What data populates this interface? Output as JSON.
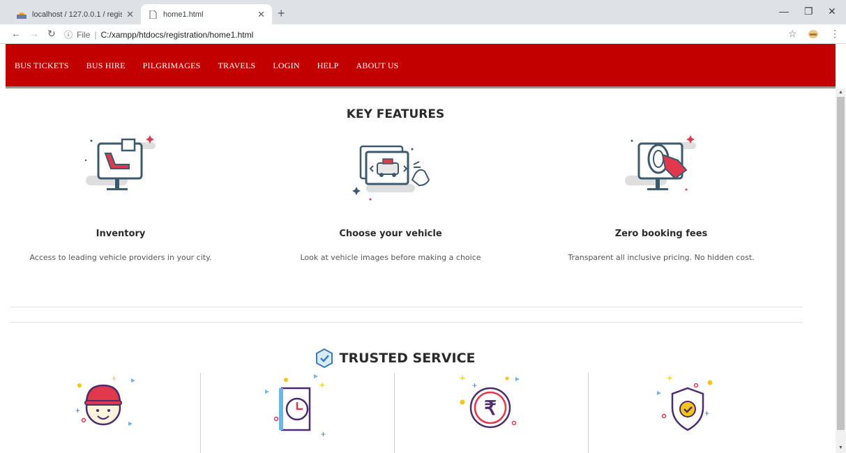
{
  "browser": {
    "tabs": [
      {
        "label": "localhost / 127.0.0.1 / registratio",
        "active": false
      },
      {
        "label": "home1.html",
        "active": true
      }
    ],
    "address": {
      "scheme_label": "File",
      "url": "C:/xampp/htdocs/registration/home1.html"
    }
  },
  "nav": {
    "items": [
      "BUS TICKETS",
      "BUS HIRE",
      "PILGRIMAGES",
      "TRAVELS",
      "LOGIN",
      "HELP",
      "ABOUT US"
    ],
    "background": "#c30000"
  },
  "key_features": {
    "title": "KEY FEATURES",
    "items": [
      {
        "title": "Inventory",
        "description": "Access to leading vehicle providers in your city.",
        "icon": "seat-monitor-icon"
      },
      {
        "title": "Choose your vehicle",
        "description": "Look at vehicle images before making a choice",
        "icon": "vehicle-gallery-icon"
      },
      {
        "title": "Zero booking fees",
        "description": "Transparent all inclusive pricing. No hidden cost.",
        "icon": "price-tag-monitor-icon"
      }
    ]
  },
  "trusted_service": {
    "title": "TRUSTED SERVICE",
    "icons": [
      "driver-face-icon",
      "clock-book-icon",
      "rupee-coin-icon",
      "shield-check-icon"
    ]
  }
}
